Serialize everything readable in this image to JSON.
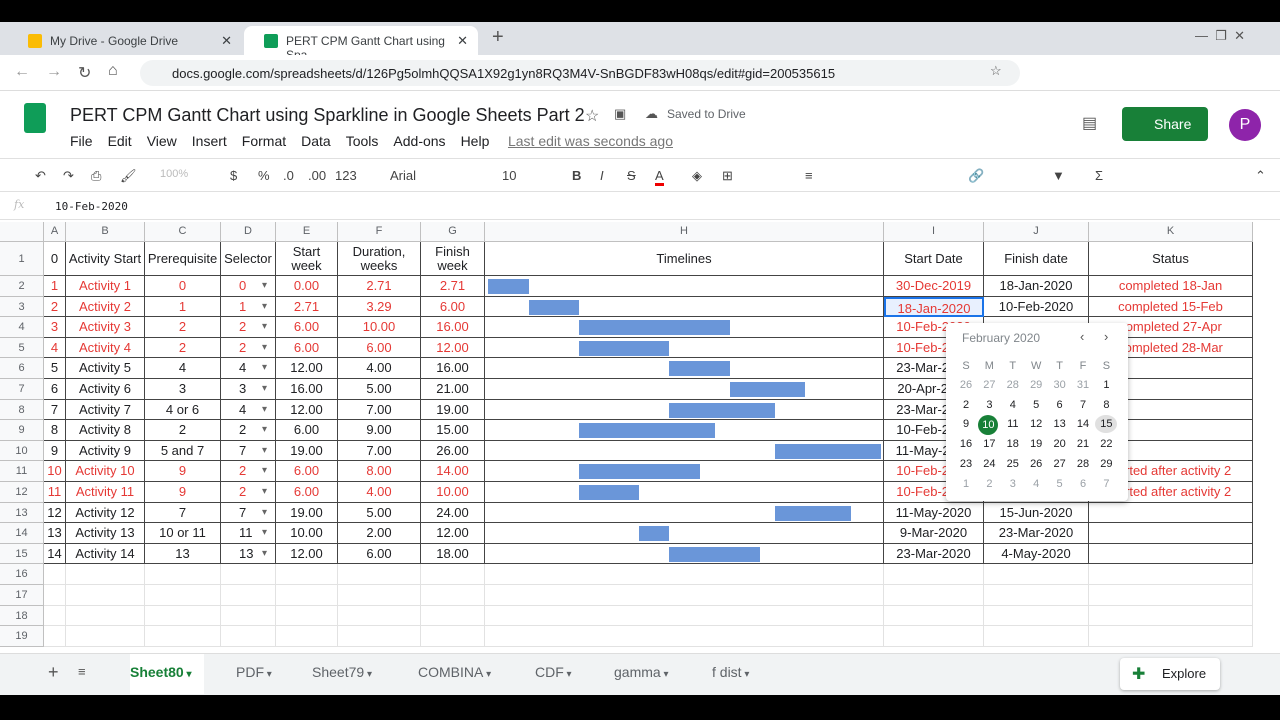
{
  "browser": {
    "tabs": [
      {
        "title": "My Drive - Google Drive",
        "active": false
      },
      {
        "title": "PERT CPM Gantt Chart using Spa",
        "active": true
      }
    ],
    "url": "docs.google.com/spreadsheets/d/126Pg5olmhQQSA1X92g1yn8RQ3M4V-SnBGDF83wH08qs/edit#gid=200535615"
  },
  "doc": {
    "title": "PERT CPM Gantt Chart using Sparkline in Google Sheets Part 2",
    "saved": "Saved to Drive",
    "share": "Share",
    "avatar": "P",
    "menu": [
      "File",
      "Edit",
      "View",
      "Insert",
      "Format",
      "Data",
      "Tools",
      "Add-ons",
      "Help"
    ],
    "last_edit": "Last edit was seconds ago"
  },
  "toolbar": {
    "zoom": "100%",
    "currency": "$",
    "percent": "%",
    "dec_less": ".0",
    "dec_more": ".00",
    "format": "123",
    "font": "Arial",
    "size": "10",
    "bold": "B",
    "italic": "I",
    "strike": "S",
    "textcolor": "A",
    "accent": "#188038"
  },
  "formula": {
    "fx": "fx",
    "value": "10-Feb-2020"
  },
  "columns": [
    "A",
    "B",
    "C",
    "D",
    "E",
    "F",
    "G",
    "H",
    "I",
    "J",
    "K"
  ],
  "headers": [
    "0",
    "Activity Start",
    "Prerequisite",
    "Selector",
    "Start week",
    "Duration, weeks",
    "Finish week",
    "Timelines",
    "Start Date",
    "Finish date",
    "Status"
  ],
  "rows": [
    [
      "1",
      "Activity 1",
      "0",
      "0",
      "0.00",
      "2.71",
      "2.71",
      "30-Dec-2019",
      "18-Jan-2020",
      "completed 18-Jan",
      true
    ],
    [
      "2",
      "Activity 2",
      "1",
      "1",
      "2.71",
      "3.29",
      "6.00",
      "18-Jan-2020",
      "10-Feb-2020",
      "completed 15-Feb",
      true
    ],
    [
      "3",
      "Activity 3",
      "2",
      "2",
      "6.00",
      "10.00",
      "16.00",
      "10-Feb-2020",
      "",
      "completed 27-Apr",
      true
    ],
    [
      "4",
      "Activity 4",
      "2",
      "2",
      "6.00",
      "6.00",
      "12.00",
      "10-Feb-2020",
      "",
      "completed 28-Mar",
      true
    ],
    [
      "5",
      "Activity 5",
      "4",
      "4",
      "12.00",
      "4.00",
      "16.00",
      "23-Mar-2020",
      "",
      "",
      false
    ],
    [
      "6",
      "Activity 6",
      "3",
      "3",
      "16.00",
      "5.00",
      "21.00",
      "20-Apr-2020",
      "",
      "",
      false
    ],
    [
      "7",
      "Activity 7",
      "4 or 6",
      "4",
      "12.00",
      "7.00",
      "19.00",
      "23-Mar-2020",
      "",
      "",
      false
    ],
    [
      "8",
      "Activity 8",
      "2",
      "2",
      "6.00",
      "9.00",
      "15.00",
      "10-Feb-2020",
      "",
      "",
      false
    ],
    [
      "9",
      "Activity 9",
      "5 and 7",
      "7",
      "19.00",
      "7.00",
      "26.00",
      "11-May-2020",
      "",
      "",
      false
    ],
    [
      "10",
      "Activity 10",
      "9",
      "2",
      "6.00",
      "8.00",
      "14.00",
      "10-Feb-2020",
      "",
      "rted after activity 2",
      true
    ],
    [
      "11",
      "Activity 11",
      "9",
      "2",
      "6.00",
      "4.00",
      "10.00",
      "10-Feb-2020",
      "",
      "rted after activity 2",
      true
    ],
    [
      "12",
      "Activity 12",
      "7",
      "7",
      "19.00",
      "5.00",
      "24.00",
      "11-May-2020",
      "15-Jun-2020",
      "",
      false
    ],
    [
      "13",
      "Activity 13",
      "10 or 11",
      "11",
      "10.00",
      "2.00",
      "12.00",
      "9-Mar-2020",
      "23-Mar-2020",
      "",
      false
    ],
    [
      "14",
      "Activity 14",
      "13",
      "13",
      "12.00",
      "6.00",
      "18.00",
      "23-Mar-2020",
      "4-May-2020",
      "",
      false
    ]
  ],
  "timeline_max_weeks": 26,
  "bar_color": "#6a96d9",
  "picker": {
    "month": "February 2020",
    "weekdays": [
      "S",
      "M",
      "T",
      "W",
      "T",
      "F",
      "S"
    ],
    "weeks": [
      [
        "26",
        "27",
        "28",
        "29",
        "30",
        "31",
        "1"
      ],
      [
        "2",
        "3",
        "4",
        "5",
        "6",
        "7",
        "8"
      ],
      [
        "9",
        "10",
        "11",
        "12",
        "13",
        "14",
        "15"
      ],
      [
        "16",
        "17",
        "18",
        "19",
        "20",
        "21",
        "22"
      ],
      [
        "23",
        "24",
        "25",
        "26",
        "27",
        "28",
        "29"
      ],
      [
        "1",
        "2",
        "3",
        "4",
        "5",
        "6",
        "7"
      ]
    ],
    "selected": "10",
    "hovered": "15"
  },
  "sheets": [
    "Sheet80",
    "PDF",
    "Sheet79",
    "COMBINA",
    "CDF",
    "gamma",
    "f dist"
  ],
  "active_sheet": "Sheet80",
  "explore": "Explore"
}
